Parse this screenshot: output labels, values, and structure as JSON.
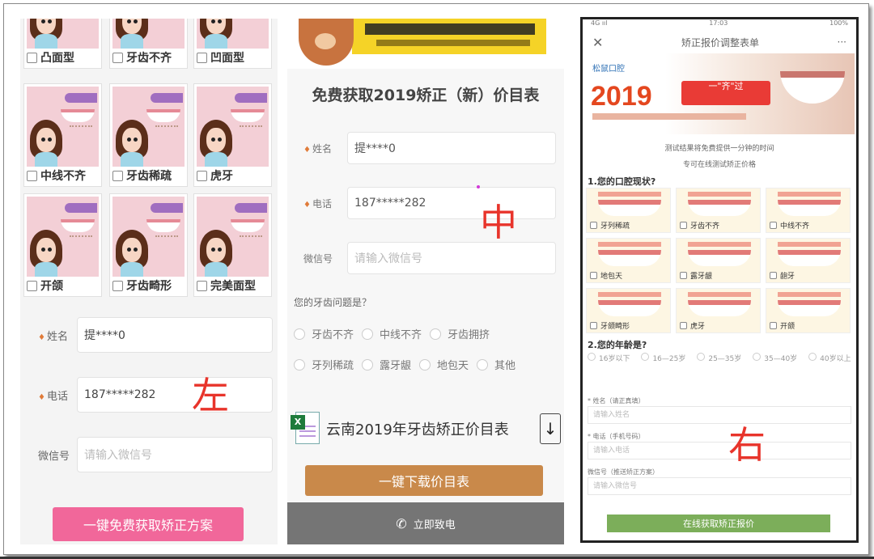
{
  "left": {
    "cells": [
      {
        "label": "凸面型"
      },
      {
        "label": "牙齿不齐"
      },
      {
        "label": "凹面型"
      },
      {
        "label": "中线不齐"
      },
      {
        "label": "牙齿稀疏"
      },
      {
        "label": "虎牙"
      },
      {
        "label": "开颌"
      },
      {
        "label": "牙齿畸形"
      },
      {
        "label": "完美面型"
      }
    ],
    "name_label": "姓名",
    "name_value": "提****0",
    "phone_label": "电话",
    "phone_value": "187*****282",
    "wechat_label": "微信号",
    "wechat_placeholder": "请输入微信号",
    "button": "一键免费获取矫正方案",
    "marker": "左"
  },
  "middle": {
    "title": "免费获取2019矫正（新）价目表",
    "name_label": "姓名",
    "name_value": "提****0",
    "phone_label": "电话",
    "phone_value": "187*****282",
    "wechat_label": "微信号",
    "wechat_placeholder": "请输入微信号",
    "question": "您的牙齿问题是？",
    "options_row1": [
      "牙齿不齐",
      "中线不齐",
      "牙齿拥挤"
    ],
    "options_row2": [
      "牙列稀疏",
      "露牙龈",
      "地包天",
      "其他"
    ],
    "file_title": "云南2019年牙齿矫正价目表",
    "download_button": "一键下载价目表",
    "call_button": "立即致电",
    "marker": "中"
  },
  "right": {
    "status_left": "4G ııl",
    "status_time": "17:03",
    "status_right": "100%",
    "nav_title": "矫正报价调整表单",
    "nav_more": "···",
    "banner_logo": "松鼠口腔",
    "banner_year": "2019",
    "banner_slogan": "一\"齐\"过",
    "intro1": "测试结果将免费提供一分钟的时间",
    "intro2": "专可在线测试矫正价格",
    "q1": "1.您的口腔现状?",
    "tiles": [
      "牙列稀疏",
      "牙齿不齐",
      "中线不齐",
      "地包天",
      "露牙龈",
      "龅牙",
      "牙颌畸形",
      "虎牙",
      "开颌"
    ],
    "q2": "2.您的年龄是?",
    "ages": [
      "16岁以下",
      "16—25岁",
      "25—35岁",
      "35—40岁",
      "40岁以上"
    ],
    "field1_label": "* 姓名（请正真填）",
    "field1_ph": "请输入姓名",
    "field2_label": "* 电话（手机号码）",
    "field2_ph": "请输入电话",
    "field3_label": "微信号（推送矫正方案）",
    "field3_ph": "请输入微信号",
    "button": "在线获取矫正报价",
    "marker": "右"
  }
}
